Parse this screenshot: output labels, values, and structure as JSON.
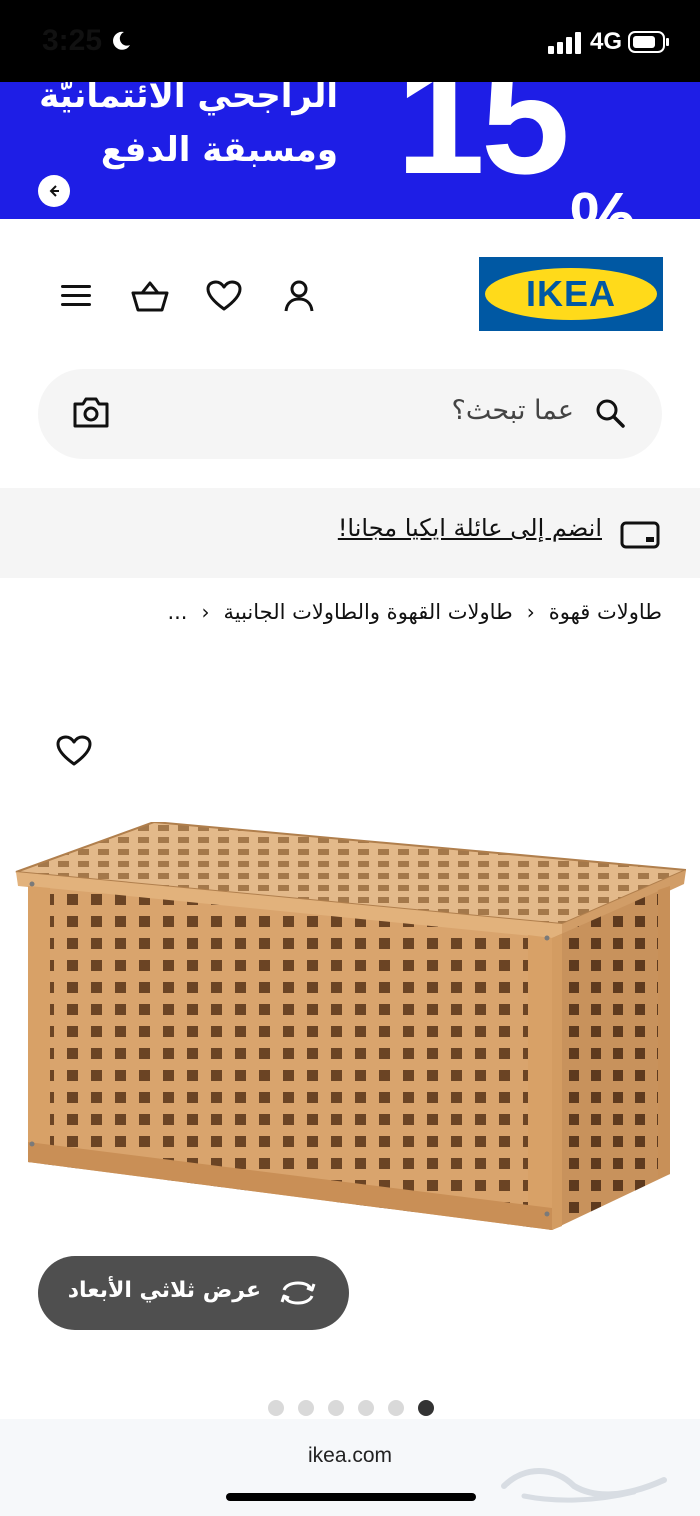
{
  "status_bar": {
    "time": "3:25",
    "network": "4G"
  },
  "promo": {
    "line1": "الراجحي الائتمانيّة",
    "line2": "ومسبقة الدفع",
    "discount": "15",
    "percent": "%"
  },
  "header": {
    "logo_text": "IKEA"
  },
  "search": {
    "placeholder": "عما تبحث؟"
  },
  "family": {
    "text": "انضم إلى عائلة ايكيا مجانا!"
  },
  "breadcrumb": {
    "items": [
      "طاولات قهوة",
      "طاولات القهوة والطاولات الجانبية",
      "..."
    ]
  },
  "product": {
    "view3d_label": "عرض ثلاثي الأبعاد"
  },
  "carousel": {
    "count": 6,
    "active": 6
  },
  "browser": {
    "url": "ikea.com"
  },
  "colors": {
    "promo_bg": "#1e1ee6",
    "logo_blue": "#0058a3",
    "logo_yellow": "#ffda1a",
    "button_bg": "#4f4f4f"
  }
}
